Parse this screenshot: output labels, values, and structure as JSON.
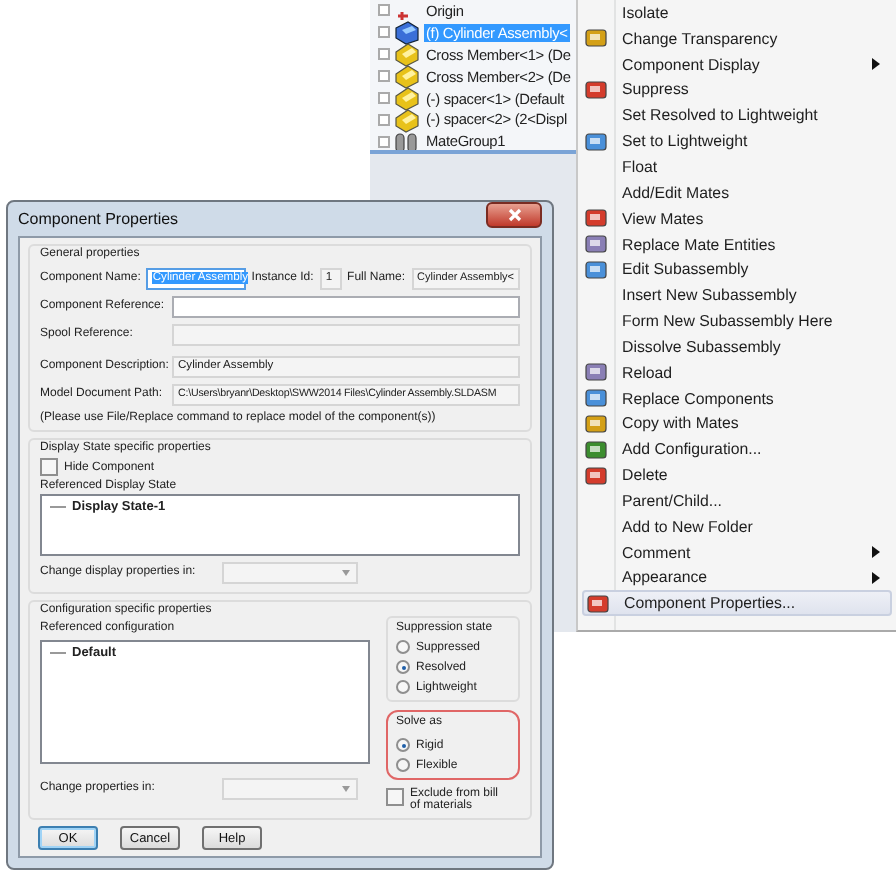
{
  "feature_tree": {
    "items": [
      {
        "label": "Origin",
        "kind": "origin",
        "selected": false
      },
      {
        "label": "(f) Cylinder Assembly<",
        "kind": "assembly",
        "selected": true
      },
      {
        "label": "Cross Member<1> (De",
        "kind": "part",
        "selected": false
      },
      {
        "label": "Cross Member<2> (De",
        "kind": "part",
        "selected": false
      },
      {
        "label": "(-) spacer<1> (Default",
        "kind": "part",
        "selected": false
      },
      {
        "label": "(-) spacer<2> (2<Displ",
        "kind": "part",
        "selected": false
      },
      {
        "label": "MateGroup1",
        "kind": "mates",
        "selected": false
      }
    ]
  },
  "context_menu": {
    "items": [
      {
        "label": "Isolate",
        "has_icon": false,
        "has_submenu": false,
        "selected": false
      },
      {
        "label": "Change Transparency",
        "has_icon": true,
        "has_submenu": false,
        "selected": false
      },
      {
        "label": "Component Display",
        "has_icon": false,
        "has_submenu": true,
        "selected": false
      },
      {
        "label": "Suppress",
        "has_icon": true,
        "has_submenu": false,
        "selected": false
      },
      {
        "label": "Set Resolved to Lightweight",
        "has_icon": false,
        "has_submenu": false,
        "selected": false
      },
      {
        "label": "Set to Lightweight",
        "has_icon": true,
        "has_submenu": false,
        "selected": false
      },
      {
        "label": "Float",
        "has_icon": false,
        "has_submenu": false,
        "selected": false
      },
      {
        "label": "Add/Edit Mates",
        "has_icon": false,
        "has_submenu": false,
        "selected": false
      },
      {
        "label": "View Mates",
        "has_icon": true,
        "has_submenu": false,
        "selected": false
      },
      {
        "label": "Replace Mate Entities",
        "has_icon": true,
        "has_submenu": false,
        "selected": false
      },
      {
        "label": "Edit Subassembly",
        "has_icon": true,
        "has_submenu": false,
        "selected": false
      },
      {
        "label": "Insert New Subassembly",
        "has_icon": false,
        "has_submenu": false,
        "selected": false
      },
      {
        "label": "Form New Subassembly Here",
        "has_icon": false,
        "has_submenu": false,
        "selected": false
      },
      {
        "label": "Dissolve Subassembly",
        "has_icon": false,
        "has_submenu": false,
        "selected": false
      },
      {
        "label": "Reload",
        "has_icon": true,
        "has_submenu": false,
        "selected": false
      },
      {
        "label": "Replace Components",
        "has_icon": true,
        "has_submenu": false,
        "selected": false
      },
      {
        "label": "Copy with Mates",
        "has_icon": true,
        "has_submenu": false,
        "selected": false
      },
      {
        "label": "Add Configuration...",
        "has_icon": true,
        "has_submenu": false,
        "selected": false
      },
      {
        "label": "Delete",
        "has_icon": true,
        "has_submenu": false,
        "selected": false
      },
      {
        "label": "Parent/Child...",
        "has_icon": false,
        "has_submenu": false,
        "selected": false
      },
      {
        "label": "Add to New Folder",
        "has_icon": false,
        "has_submenu": false,
        "selected": false
      },
      {
        "label": "Comment",
        "has_icon": false,
        "has_submenu": true,
        "selected": false
      },
      {
        "label": "Appearance",
        "has_icon": false,
        "has_submenu": true,
        "selected": false
      },
      {
        "label": "Component Properties...",
        "has_icon": true,
        "has_submenu": false,
        "selected": true
      }
    ]
  },
  "dialog": {
    "title": "Component Properties",
    "general": {
      "title": "General properties",
      "component_name": {
        "label": "Component Name:",
        "value": "Cylinder Assembly"
      },
      "instance_id": {
        "label": "Instance Id:",
        "value": "1"
      },
      "full_name": {
        "label": "Full Name:",
        "value": "Cylinder Assembly<"
      },
      "component_reference": {
        "label": "Component Reference:"
      },
      "spool_reference": {
        "label": "Spool Reference:"
      },
      "component_description": {
        "label": "Component Description:",
        "value": "Cylinder Assembly"
      },
      "model_document_path": {
        "label": "Model Document Path:",
        "value": "C:\\Users\\bryanr\\Desktop\\SWW2014 Files\\Cylinder Assembly.SLDASM"
      },
      "note": "(Please use File/Replace command to replace model of the component(s))"
    },
    "display_state": {
      "title": "Display State specific properties",
      "hide_component": {
        "label": "Hide Component",
        "checked": false
      },
      "list_title": "Referenced Display State",
      "items": [
        "Display State-1"
      ],
      "change_label": "Change display properties in:"
    },
    "configuration": {
      "title": "Configuration specific properties",
      "list_title": "Referenced configuration",
      "items": [
        "Default"
      ],
      "change_label": "Change properties in:"
    },
    "suppression_state": {
      "title": "Suppression state",
      "options": [
        {
          "label": "Suppressed",
          "selected": false
        },
        {
          "label": "Resolved",
          "selected": true
        },
        {
          "label": "Lightweight",
          "selected": false
        }
      ]
    },
    "solve_as": {
      "title": "Solve as",
      "highlighted": true,
      "options": [
        {
          "label": "Rigid",
          "selected": true
        },
        {
          "label": "Flexible",
          "selected": false
        }
      ]
    },
    "exclude_from_bom": {
      "label": "Exclude from bill of materials",
      "checked": false
    },
    "buttons": [
      {
        "label": "OK",
        "default": true
      },
      {
        "label": "Cancel",
        "default": false
      },
      {
        "label": "Help",
        "default": false
      }
    ]
  }
}
